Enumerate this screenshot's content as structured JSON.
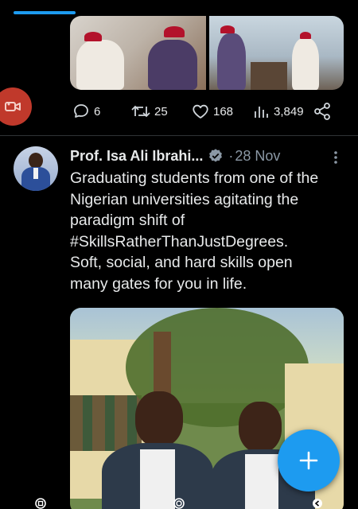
{
  "previous_tweet": {
    "stats": {
      "replies": "6",
      "retweets": "25",
      "likes": "168",
      "views": "3,849"
    }
  },
  "tweet": {
    "author_name": "Prof. Isa Ali Ibrahi...",
    "separator": "·",
    "date": "28 Nov",
    "text_lines": [
      "Graduating students from one of the",
      "Nigerian universities agitating the",
      "paradigm shift of",
      "#SkillsRatherThanJustDegrees.",
      "Soft, social, and hard skills open",
      "many gates for you in life."
    ]
  },
  "icons": {
    "camera": "video-camera-icon",
    "reply": "reply-icon",
    "retweet": "retweet-icon",
    "like": "heart-icon",
    "views": "views-icon",
    "share": "share-icon",
    "verified": "verified-badge-icon",
    "more": "more-options-icon",
    "compose": "plus-icon"
  },
  "colors": {
    "accent": "#1d9bf0",
    "camera_fab": "#c0392b",
    "muted": "#8b98a5",
    "text": "#e7e9ea",
    "background": "#000000"
  }
}
